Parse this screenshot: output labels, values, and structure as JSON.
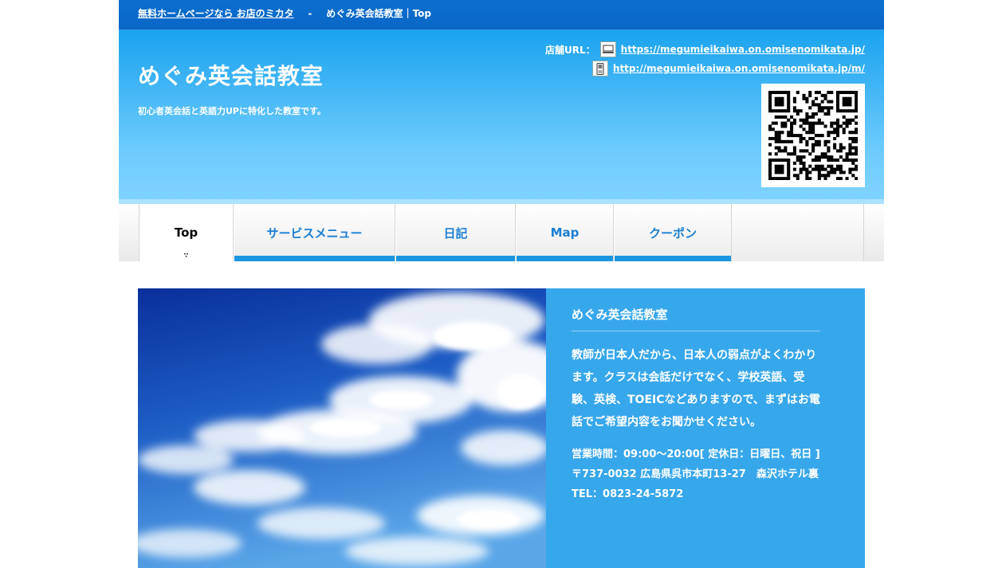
{
  "topbar": {
    "link_text": "無料ホームページなら お店のミカタ",
    "separator": "-",
    "breadcrumb": "めぐみ英会話教室｜Top"
  },
  "header": {
    "title": "めぐみ英会話教室",
    "description": "初心者英会話と英語力UPに特化した教室です。",
    "url_label": "店舗URL：",
    "pc_url": "https://megumieikaiwa.on.omisenomikata.jp/",
    "mobile_url": "http://megumieikaiwa.on.omisenomikata.jp/m/",
    "pc_icon": "computer-icon",
    "mobile_icon": "mobile-phone-icon"
  },
  "nav": {
    "items": [
      {
        "label": "Top",
        "active": true
      },
      {
        "label": "サービスメニュー"
      },
      {
        "label": "日記"
      },
      {
        "label": "Map"
      },
      {
        "label": "クーポン"
      }
    ],
    "active_marker": "∵"
  },
  "info": {
    "title": "めぐみ英会話教室",
    "body": "教師が日本人だから、日本人の弱点がよくわかります。クラスは会話だけでなく、学校英語、受験、英検、TOEICなどありますので、まずはお電話でご希望内容をお聞かせください。",
    "hours": "営業時間：09:00～20:00[ 定休日：日曜日、祝日 ]",
    "address": "〒737-0032 広島県呉市本町13-27　森沢ホテル裏",
    "tel": "TEL：0823-24-5872"
  },
  "colors": {
    "topbar": "#0a6bcb",
    "accent": "#1b95e0",
    "info_bg": "#37a7ec"
  }
}
